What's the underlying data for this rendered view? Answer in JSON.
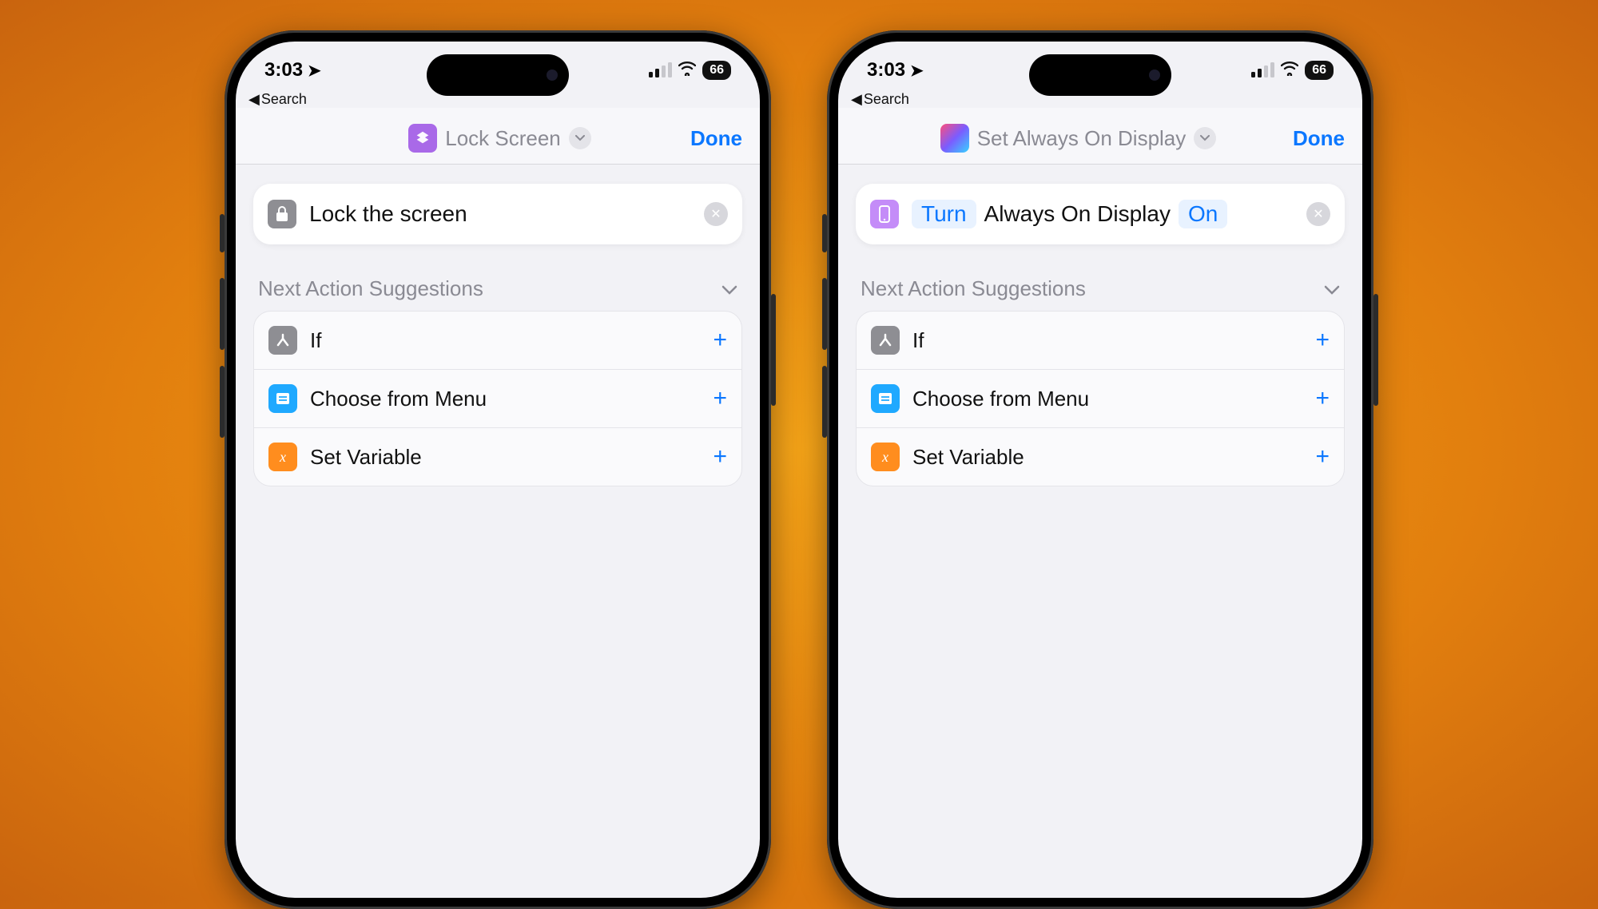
{
  "status": {
    "time": "3:03",
    "back_label": "Search",
    "battery": "66"
  },
  "phones": [
    {
      "title": "Lock Screen",
      "done": "Done",
      "action": {
        "icon_color": "grey",
        "icon_glyph": "lock",
        "text": "Lock the screen",
        "pills": []
      },
      "suggestions_header": "Next Action Suggestions",
      "suggestions": [
        {
          "icon": "branch",
          "color": "grey",
          "label": "If"
        },
        {
          "icon": "menu",
          "color": "blue",
          "label": "Choose from Menu"
        },
        {
          "icon": "x",
          "color": "orange",
          "label": "Set Variable"
        }
      ],
      "app_icon": "purple"
    },
    {
      "title": "Set Always On Display",
      "done": "Done",
      "action": {
        "icon_color": "lav",
        "icon_glyph": "phone",
        "tokens": [
          {
            "kind": "pill",
            "text": "Turn"
          },
          {
            "kind": "plain",
            "text": "Always On Display"
          },
          {
            "kind": "pill",
            "text": "On"
          }
        ]
      },
      "suggestions_header": "Next Action Suggestions",
      "suggestions": [
        {
          "icon": "branch",
          "color": "grey",
          "label": "If"
        },
        {
          "icon": "menu",
          "color": "blue",
          "label": "Choose from Menu"
        },
        {
          "icon": "x",
          "color": "orange",
          "label": "Set Variable"
        }
      ],
      "app_icon": "shortcuts"
    }
  ]
}
